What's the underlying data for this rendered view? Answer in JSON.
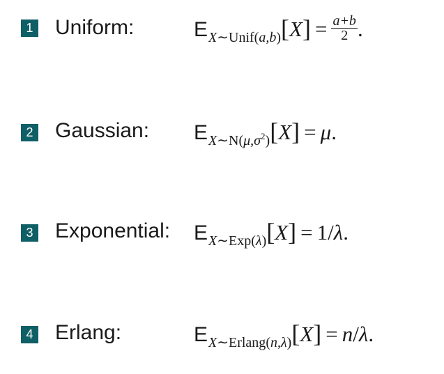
{
  "items": [
    {
      "number": "1",
      "name": "Uniform:",
      "formula": {
        "E": "E",
        "sub_var": "X",
        "sub_tilde": "∼",
        "sub_dist": "Unif",
        "sub_lparen": "(",
        "sub_args": "a,b",
        "sub_rparen": ")",
        "bracket_open": "[",
        "bracket_var": "X",
        "bracket_close": "]",
        "eq": "=",
        "frac_num": "a+b",
        "frac_den": "2",
        "end": "."
      }
    },
    {
      "number": "2",
      "name": "Gaussian:",
      "formula": {
        "E": "E",
        "sub_var": "X",
        "sub_tilde": "∼",
        "sub_dist": "N",
        "sub_lparen": "(",
        "sub_arg1": "μ,σ",
        "sub_sup": "2",
        "sub_rparen": ")",
        "bracket_open": "[",
        "bracket_var": "X",
        "bracket_close": "]",
        "eq": "=",
        "rhs": "μ",
        "end": "."
      }
    },
    {
      "number": "3",
      "name": "Exponential:",
      "formula": {
        "E": "E",
        "sub_var": "X",
        "sub_tilde": "∼",
        "sub_dist": "Exp",
        "sub_lparen": "(",
        "sub_args": "λ",
        "sub_rparen": ")",
        "bracket_open": "[",
        "bracket_var": "X",
        "bracket_close": "]",
        "eq": "=",
        "rhs_num": "1",
        "rhs_slash": "/",
        "rhs_var": "λ",
        "end": "."
      }
    },
    {
      "number": "4",
      "name": "Erlang:",
      "formula": {
        "E": "E",
        "sub_var": "X",
        "sub_tilde": "∼",
        "sub_dist": "Erlang",
        "sub_lparen": "(",
        "sub_args": "n,λ",
        "sub_rparen": ")",
        "bracket_open": "[",
        "bracket_var": "X",
        "bracket_close": "]",
        "eq": "=",
        "rhs_num": "n",
        "rhs_slash": "/",
        "rhs_var": "λ",
        "end": "."
      }
    }
  ],
  "colors": {
    "badge": "#0f5f66",
    "badge_text": "#ffffff",
    "text": "#1a1a1a"
  }
}
